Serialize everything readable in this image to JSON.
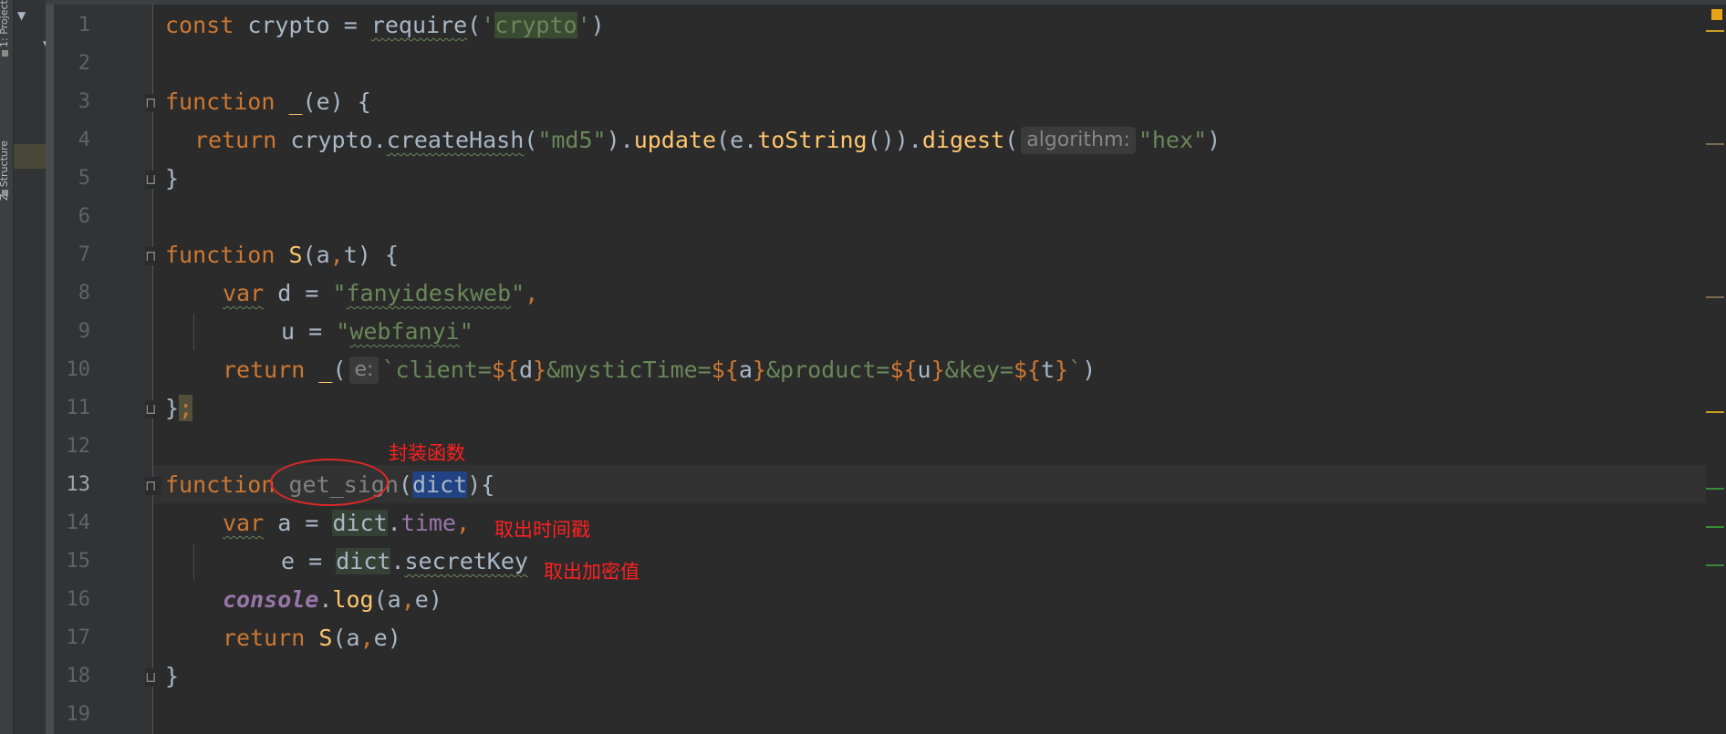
{
  "side_panel": {
    "project_label": "1: Project",
    "structure_label": "Z: Structure"
  },
  "editor": {
    "language": "javascript",
    "current_line": 13,
    "line_numbers": [
      "1",
      "2",
      "3",
      "4",
      "5",
      "6",
      "7",
      "8",
      "9",
      "10",
      "11",
      "12",
      "13",
      "14",
      "15",
      "16",
      "17",
      "18",
      "19"
    ],
    "inlay_hints": {
      "digest_param": "algorithm:",
      "hash_param": "e:"
    },
    "tokens": {
      "const": "const",
      "crypto": "crypto",
      "require": "require",
      "crypto_str": "crypto",
      "function": "function",
      "return": "return",
      "var": "var",
      "underscore_fn": "_",
      "e": "e",
      "createHash": "createHash",
      "md5": "\"md5\"",
      "update": "update",
      "toString": "toString",
      "digest": "digest",
      "hex": "\"hex\"",
      "S": "S",
      "a": "a",
      "t": "t",
      "d": "d",
      "u": "u",
      "fanyideskweb": "fanyideskweb",
      "webfanyi": "webfanyi",
      "tpl_client": "client=",
      "tpl_mystic": "&mysticTime=",
      "tpl_product": "&product=",
      "tpl_key": "&key=",
      "get_sign": "get_sign",
      "dict": "dict",
      "time": "time",
      "secretKey": "secretKey",
      "console": "console",
      "log": "log"
    }
  },
  "annotations": {
    "wrapper_function": "封装函数",
    "take_timestamp": "取出时间戳",
    "take_secret_key": "取出加密值"
  }
}
